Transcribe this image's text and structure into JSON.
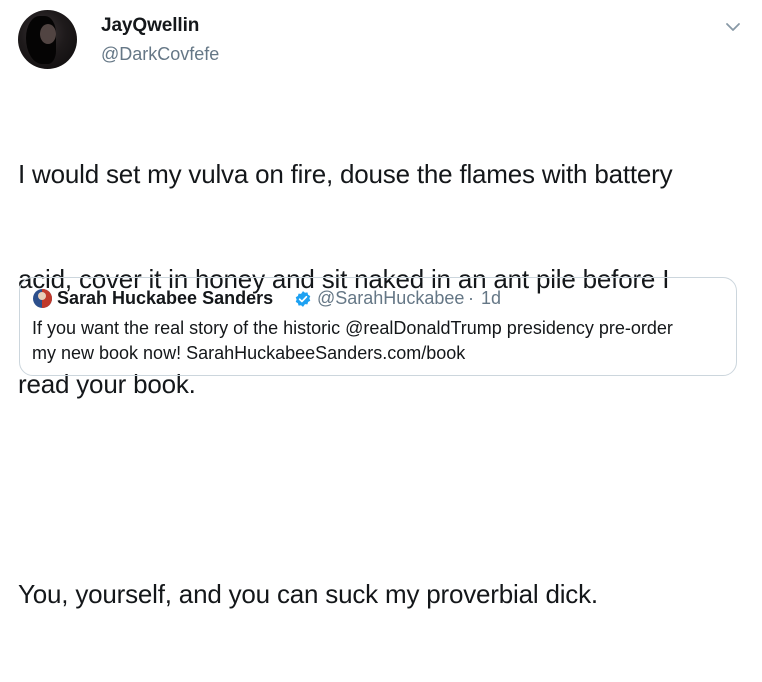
{
  "tweet": {
    "author": {
      "display_name": "JayQwellin",
      "handle": "@DarkCovfefe",
      "avatar_icon": "profile-photo"
    },
    "menu_icon": "chevron-down-icon",
    "body": {
      "line1": "I would set my vulva on fire, douse the flames with battery",
      "line2": "acid, cover it in honey and sit naked in an ant pile before I",
      "line3": "read your book.",
      "line4": "You, yourself, and you can suck my proverbial dick."
    }
  },
  "quoted_tweet": {
    "author": {
      "display_name": "Sarah Huckabee Sanders",
      "handle": "@SarahHuckabee",
      "separator": "·",
      "time": "1d",
      "verified_icon": "verified-badge-icon"
    },
    "text": {
      "line1": "If you want the real story of the historic @realDonaldTrump presidency pre-order",
      "line2": "my new book now! SarahHuckabeeSanders.com/book"
    }
  },
  "colors": {
    "text_primary": "#14171a",
    "text_secondary": "#657786",
    "border": "#ccd6dd",
    "verified_blue": "#1da1f2"
  }
}
